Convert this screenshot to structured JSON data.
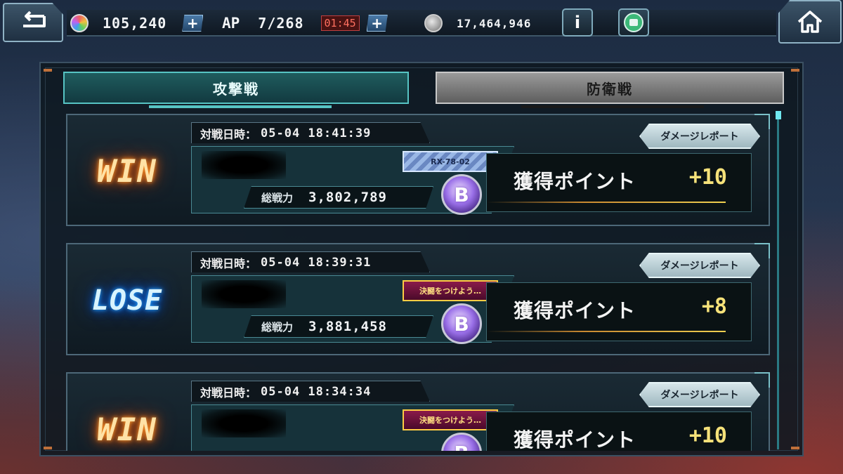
{
  "header": {
    "gems": "105,240",
    "ap_label": "AP",
    "ap_value": "7/268",
    "ap_timer": "01:45",
    "coins": "17,464,946",
    "info_label": "i"
  },
  "tabs": [
    {
      "label": "攻撃戦",
      "active": true
    },
    {
      "label": "防衛戦",
      "active": false
    }
  ],
  "common": {
    "date_label": "対戦日時：",
    "damage_report_label": "ダメージレポート",
    "power_label": "総戦力",
    "points_label": "獲得ポイント"
  },
  "battles": [
    {
      "result": "WIN",
      "datetime": "05-04 18:41:39",
      "power": "3,802,789",
      "points": "+10",
      "rank": "B",
      "badge_text": "RX-78-02"
    },
    {
      "result": "LOSE",
      "datetime": "05-04 18:39:31",
      "power": "3,881,458",
      "points": "+8",
      "rank": "B",
      "badge_text": "決闘をつけよう…"
    },
    {
      "result": "WIN",
      "datetime": "05-04 18:34:34",
      "power": "",
      "points": "+10",
      "rank": "B",
      "badge_text": "決闘をつけよう…"
    }
  ],
  "colors": {
    "win_glow": "#ff6a10",
    "lose_glow": "#0a6cff",
    "accent_teal": "#57c4c4",
    "points_yellow": "#f6e27a"
  },
  "icons": {
    "back": "back-arrow-icon",
    "home": "home-icon",
    "gem": "gem-icon",
    "coin": "coin-icon",
    "globe": "globe-icon"
  }
}
